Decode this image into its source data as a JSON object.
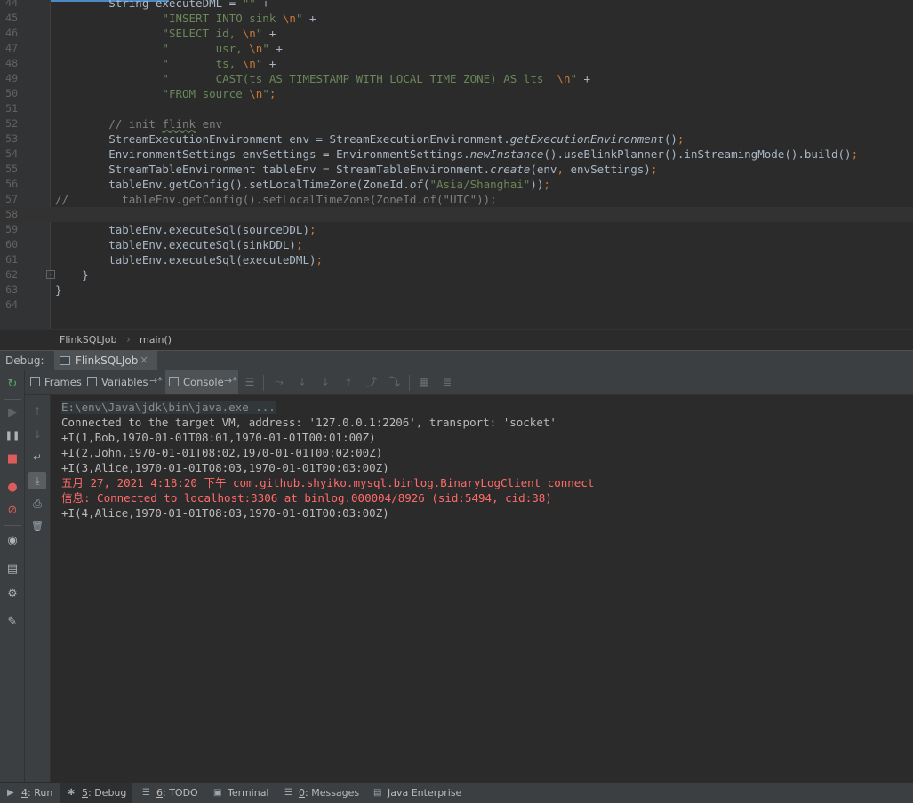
{
  "editor": {
    "lines": [
      {
        "num": "44",
        "tokens": [
          {
            "t": "        String executeDML = ",
            "c": ""
          },
          {
            "t": "\"\"",
            "c": "t-str"
          },
          {
            "t": " +",
            "c": ""
          }
        ]
      },
      {
        "num": "45",
        "tokens": [
          {
            "t": "                ",
            "c": ""
          },
          {
            "t": "\"INSERT INTO sink ",
            "c": "t-str"
          },
          {
            "t": "\\n",
            "c": "t-esc"
          },
          {
            "t": "\"",
            "c": "t-str"
          },
          {
            "t": " +",
            "c": ""
          }
        ]
      },
      {
        "num": "46",
        "tokens": [
          {
            "t": "                ",
            "c": ""
          },
          {
            "t": "\"SELECT id, ",
            "c": "t-str"
          },
          {
            "t": "\\n",
            "c": "t-esc"
          },
          {
            "t": "\"",
            "c": "t-str"
          },
          {
            "t": " +",
            "c": ""
          }
        ]
      },
      {
        "num": "47",
        "tokens": [
          {
            "t": "                ",
            "c": ""
          },
          {
            "t": "\"       usr, ",
            "c": "t-str"
          },
          {
            "t": "\\n",
            "c": "t-esc"
          },
          {
            "t": "\"",
            "c": "t-str"
          },
          {
            "t": " +",
            "c": ""
          }
        ]
      },
      {
        "num": "48",
        "tokens": [
          {
            "t": "                ",
            "c": ""
          },
          {
            "t": "\"       ts, ",
            "c": "t-str"
          },
          {
            "t": "\\n",
            "c": "t-esc"
          },
          {
            "t": "\"",
            "c": "t-str"
          },
          {
            "t": " +",
            "c": ""
          }
        ]
      },
      {
        "num": "49",
        "tokens": [
          {
            "t": "                ",
            "c": ""
          },
          {
            "t": "\"       CAST(ts AS TIMESTAMP WITH LOCAL TIME ZONE) AS lts  ",
            "c": "t-str"
          },
          {
            "t": "\\n",
            "c": "t-esc"
          },
          {
            "t": "\"",
            "c": "t-str"
          },
          {
            "t": " +",
            "c": ""
          }
        ]
      },
      {
        "num": "50",
        "tokens": [
          {
            "t": "                ",
            "c": ""
          },
          {
            "t": "\"FROM source ",
            "c": "t-str"
          },
          {
            "t": "\\n",
            "c": "t-esc"
          },
          {
            "t": "\"",
            "c": "t-str"
          },
          {
            "t": ";",
            "c": "t-kw"
          }
        ]
      },
      {
        "num": "51",
        "tokens": []
      },
      {
        "num": "52",
        "tokens": [
          {
            "t": "        ",
            "c": ""
          },
          {
            "t": "// init ",
            "c": "t-com"
          },
          {
            "t": "flink",
            "c": "t-com t-und"
          },
          {
            "t": " env",
            "c": "t-com"
          }
        ]
      },
      {
        "num": "53",
        "tokens": [
          {
            "t": "        StreamExecutionEnvironment env = StreamExecutionEnvironment.",
            "c": ""
          },
          {
            "t": "getExecutionEnvironment",
            "c": "t-it"
          },
          {
            "t": "()",
            "c": ""
          },
          {
            "t": ";",
            "c": "t-kw"
          }
        ]
      },
      {
        "num": "54",
        "tokens": [
          {
            "t": "        EnvironmentSettings envSettings = EnvironmentSettings.",
            "c": ""
          },
          {
            "t": "newInstance",
            "c": "t-it"
          },
          {
            "t": "().useBlinkPlanner().inStreamingMode().build()",
            "c": ""
          },
          {
            "t": ";",
            "c": "t-kw"
          }
        ]
      },
      {
        "num": "55",
        "tokens": [
          {
            "t": "        StreamTableEnvironment tableEnv = StreamTableEnvironment.",
            "c": ""
          },
          {
            "t": "create",
            "c": "t-it"
          },
          {
            "t": "(env",
            "c": ""
          },
          {
            "t": ",",
            "c": "t-kw"
          },
          {
            "t": " envSettings)",
            "c": ""
          },
          {
            "t": ";",
            "c": "t-kw"
          }
        ]
      },
      {
        "num": "56",
        "tokens": [
          {
            "t": "        tableEnv.getConfig().setLocalTimeZone(ZoneId.",
            "c": ""
          },
          {
            "t": "of",
            "c": "t-it"
          },
          {
            "t": "(",
            "c": ""
          },
          {
            "t": "\"Asia/Shanghai\"",
            "c": "t-str"
          },
          {
            "t": "))",
            "c": ""
          },
          {
            "t": ";",
            "c": "t-kw"
          }
        ]
      },
      {
        "num": "57",
        "tokens": [
          {
            "t": "//        tableEnv.getConfig().setLocalTimeZone(ZoneId.of(\"UTC\"));",
            "c": "t-com"
          }
        ]
      },
      {
        "num": "58",
        "tokens": [],
        "current": true
      },
      {
        "num": "59",
        "tokens": [
          {
            "t": "        tableEnv.executeSql(sourceDDL)",
            "c": ""
          },
          {
            "t": ";",
            "c": "t-kw"
          }
        ]
      },
      {
        "num": "60",
        "tokens": [
          {
            "t": "        tableEnv.executeSql(sinkDDL)",
            "c": ""
          },
          {
            "t": ";",
            "c": "t-kw"
          }
        ]
      },
      {
        "num": "61",
        "tokens": [
          {
            "t": "        tableEnv.executeSql(executeDML)",
            "c": ""
          },
          {
            "t": ";",
            "c": "t-kw"
          }
        ]
      },
      {
        "num": "62",
        "tokens": [
          {
            "t": "    }",
            "c": ""
          }
        ]
      },
      {
        "num": "63",
        "tokens": [
          {
            "t": "}",
            "c": ""
          }
        ]
      },
      {
        "num": "64",
        "tokens": []
      }
    ]
  },
  "breadcrumb": {
    "items": [
      "FlinkSQLJob",
      "main()"
    ],
    "separator": "›"
  },
  "debug": {
    "title": "Debug:",
    "session_tab": "FlinkSQLJob",
    "close_glyph": "×",
    "settings_glyph": "⚙",
    "tabs": [
      {
        "label": "Frames"
      },
      {
        "label": "Variables"
      },
      {
        "label": "Console"
      }
    ],
    "pin_glyph": "→*",
    "toolbar_glyphs": [
      "☰",
      "⤳",
      "⤓",
      "⤓",
      "⤒",
      "⤴",
      "⤵",
      "▦",
      "≣"
    ]
  },
  "left_strip": {
    "glyphs": [
      "↻",
      "▶",
      "❚❚",
      "■",
      "●",
      "⊘",
      "◉",
      "▤",
      "⚙",
      "✎"
    ]
  },
  "console_strip": {
    "glyphs": [
      "↑",
      "↓",
      "↵",
      "⤓",
      "⎙",
      "🗑"
    ]
  },
  "console": {
    "lines": [
      {
        "text": "E:\\env\\Java\\jdk\\bin\\java.exe ...",
        "kind": "cmd"
      },
      {
        "text": "Connected to the target VM, address: '127.0.0.1:2206', transport: 'socket'",
        "kind": "out"
      },
      {
        "text": "+I(1,Bob,1970-01-01T08:01,1970-01-01T00:01:00Z)",
        "kind": "out"
      },
      {
        "text": "+I(2,John,1970-01-01T08:02,1970-01-01T00:02:00Z)",
        "kind": "out"
      },
      {
        "text": "+I(3,Alice,1970-01-01T08:03,1970-01-01T00:03:00Z)",
        "kind": "out"
      },
      {
        "text": "五月 27, 2021 4:18:20 下午 com.github.shyiko.mysql.binlog.BinaryLogClient connect",
        "kind": "err"
      },
      {
        "text": "信息: Connected to localhost:3306 at binlog.000004/8926 (sid:5494, cid:38)",
        "kind": "err"
      },
      {
        "text": "+I(4,Alice,1970-01-01T08:03,1970-01-01T00:03:00Z)",
        "kind": "out"
      }
    ]
  },
  "bottom_bar": {
    "tabs": [
      {
        "icon": "▶",
        "key": "4",
        "label": ": Run",
        "active": false
      },
      {
        "icon": "✱",
        "key": "5",
        "label": ": Debug",
        "active": true
      },
      {
        "icon": "☰",
        "key": "6",
        "label": ": TODO",
        "active": false
      },
      {
        "icon": "▣",
        "key": "",
        "label": "Terminal",
        "active": false
      },
      {
        "icon": "☰",
        "key": "0",
        "label": ": Messages",
        "active": false
      },
      {
        "icon": "▤",
        "key": "",
        "label": "Java Enterprise",
        "active": false
      }
    ]
  },
  "colors": {
    "background": "#2b2b2b",
    "panel": "#3c3f41",
    "string": "#6a8759",
    "keyword": "#cc7832",
    "comment": "#808080",
    "error_text": "#ff6b68",
    "text": "#a9b7c6"
  }
}
